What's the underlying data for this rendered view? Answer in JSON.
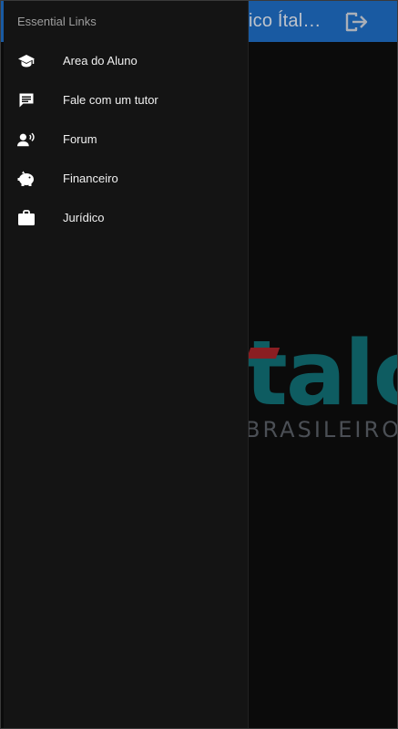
{
  "app": {
    "title": "ico Ítal…"
  },
  "logo": {
    "word": "talo",
    "subtitle": "BRASILEIRO"
  },
  "drawer": {
    "header": "Essential Links",
    "items": [
      {
        "label": "Area do Aluno",
        "icon": "graduation-cap-icon"
      },
      {
        "label": "Fale com um tutor",
        "icon": "chat-message-icon"
      },
      {
        "label": "Forum",
        "icon": "speaking-person-icon"
      },
      {
        "label": "Financeiro",
        "icon": "piggy-bank-icon"
      },
      {
        "label": "Jurídico",
        "icon": "briefcase-icon"
      }
    ]
  },
  "colors": {
    "header_bg": "#1f6ec5",
    "drawer_bg": "#141414",
    "logo_teal": "#0e5c61",
    "logo_red": "#8a1e22"
  }
}
